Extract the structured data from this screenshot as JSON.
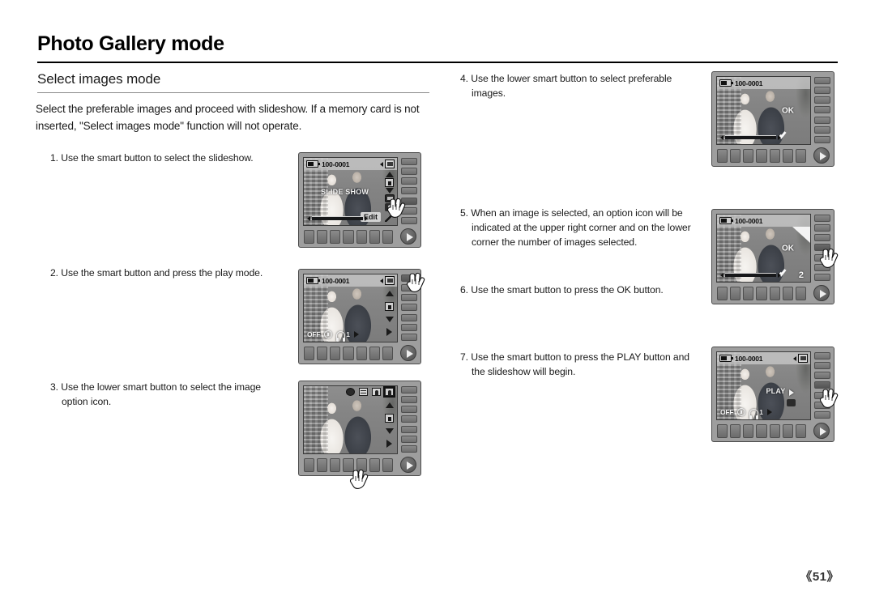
{
  "document": {
    "page_title": "Photo Gallery mode",
    "section_title": "Select images mode",
    "intro": "Select the preferable images and proceed with slideshow. If a memory card is not inserted, \"Select images mode\" function will not operate.",
    "page_number": "《51》"
  },
  "steps": [
    {
      "id": 1,
      "text": "1. Use the smart button to select the slideshow."
    },
    {
      "id": 2,
      "text": "2. Use the smart button and press the play mode."
    },
    {
      "id": 3,
      "text": "3. Use the lower smart button to select the image option icon."
    },
    {
      "id": 4,
      "text": "4. Use the lower smart button to select preferable images."
    },
    {
      "id": 5,
      "text": "5. When an image is selected, an option icon will be indicated at the upper right corner and on the lower corner the number of images selected."
    },
    {
      "id": 6,
      "text": "6. Use the smart button to press the OK button."
    },
    {
      "id": 7,
      "text": "7. Use the smart button to press the PLAY button and the slideshow will begin."
    }
  ],
  "cameras": [
    {
      "id": "camera-1",
      "step": 1,
      "file_number": "100-0001",
      "screen_label": "SLIDE SHOW",
      "edit_label": "Edit",
      "has_topbar": true,
      "has_mode_box": true,
      "has_scrubbar": true,
      "has_iconbar": true,
      "pressed_side_button_index": 4
    },
    {
      "id": "camera-2",
      "step": 2,
      "file_number": "100-0001",
      "status_off": "OFF",
      "status_headphone_level": "1",
      "has_topbar": true,
      "has_mode_box": true,
      "has_iconbar": true,
      "pressed_side_button_index": 0
    },
    {
      "id": "camera-3",
      "step": 3,
      "option_icons": [
        "lens-icon",
        "grid-icon",
        "portrait-icon",
        "image-option-icon"
      ],
      "selected_option_index": 3,
      "has_iconbar": true
    },
    {
      "id": "camera-4",
      "step": 4,
      "file_number": "100-0001",
      "ok_label": "OK",
      "has_topbar": true,
      "has_check": true,
      "has_scrubbar": true
    },
    {
      "id": "camera-5",
      "step": 5,
      "file_number": "100-0001",
      "ok_label": "OK",
      "selected_count": "2",
      "has_topbar": true,
      "has_check": true,
      "has_corner_marker": true,
      "has_scrubbar": true,
      "pressed_side_button_index": 3
    },
    {
      "id": "camera-6",
      "step": 7,
      "file_number": "100-0001",
      "screen_label": "PLAY",
      "status_off": "OFF",
      "status_headphone_level": "1",
      "has_topbar": true,
      "has_mode_box": true,
      "pressed_side_button_index": 3
    }
  ],
  "colors": {
    "page_background": "#ffffff",
    "text": "#1a1a1a",
    "rule": "#000000",
    "section_rule": "#8a8a8a",
    "camera_body": "#9e9e9e",
    "lcd_background": "#8d8d8d"
  }
}
